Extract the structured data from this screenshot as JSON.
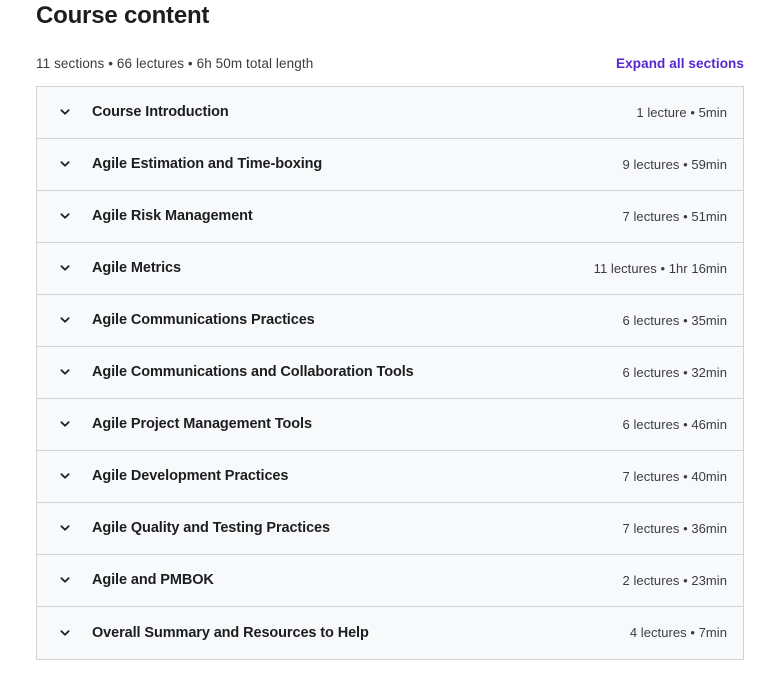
{
  "header": {
    "title": "Course content",
    "summary": "11 sections • 66 lectures • 6h 50m total length",
    "expand_all_label": "Expand all sections",
    "accent_color": "#5624d0"
  },
  "accordion": {
    "chevron_icon": "chevron-down-icon",
    "sections": [
      {
        "title": "Course Introduction",
        "meta": "1 lecture • 5min"
      },
      {
        "title": "Agile Estimation and Time-boxing",
        "meta": "9 lectures • 59min"
      },
      {
        "title": "Agile Risk Management",
        "meta": "7 lectures • 51min"
      },
      {
        "title": "Agile Metrics",
        "meta": "11 lectures • 1hr 16min"
      },
      {
        "title": "Agile Communications Practices",
        "meta": "6 lectures • 35min"
      },
      {
        "title": "Agile Communications and Collaboration Tools",
        "meta": "6 lectures • 32min"
      },
      {
        "title": "Agile Project Management Tools",
        "meta": "6 lectures • 46min"
      },
      {
        "title": "Agile Development Practices",
        "meta": "7 lectures • 40min"
      },
      {
        "title": "Agile Quality and Testing Practices",
        "meta": "7 lectures • 36min"
      },
      {
        "title": "Agile and PMBOK",
        "meta": "2 lectures • 23min"
      },
      {
        "title": "Overall Summary and Resources to Help",
        "meta": "4 lectures • 7min"
      }
    ]
  }
}
